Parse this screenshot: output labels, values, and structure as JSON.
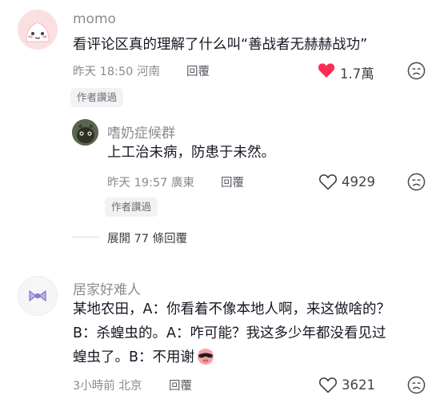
{
  "comments": [
    {
      "username": "momo",
      "text": "看评论区真的理解了什么叫“善战者无赫赫战功”",
      "time": "昨天 18:50",
      "location": "河南",
      "reply_label": "回覆",
      "likes": "1.7萬",
      "liked": true,
      "badge": "作者讚過",
      "replies": [
        {
          "username": "嗜奶症候群",
          "text": "上工治未病，防患于未然。",
          "time": "昨天 19:57",
          "location": "廣東",
          "reply_label": "回覆",
          "likes": "4929",
          "liked": false,
          "badge": "作者讚過"
        }
      ],
      "expand_label": "展開 77 條回覆"
    },
    {
      "username": "居家好难人",
      "text_lines": [
        "某地农田，A：你看着不像本地人啊，来这做啥的？",
        "B：杀蝗虫的。A：咋可能？我这多少年都没看见过",
        "蝗虫了。B：不用谢"
      ],
      "time": "3小時前",
      "location": "北京",
      "reply_label": "回覆",
      "likes": "3621",
      "liked": false
    }
  ],
  "icons": {
    "heart_filled": "heart-filled-icon",
    "heart_outline": "heart-outline-icon",
    "dislike": "frown-icon",
    "emoji": "pig-sunglasses-emoji"
  },
  "colors": {
    "liked": "#fe2c55",
    "text": "#161823",
    "secondary": "#8a8b91"
  }
}
